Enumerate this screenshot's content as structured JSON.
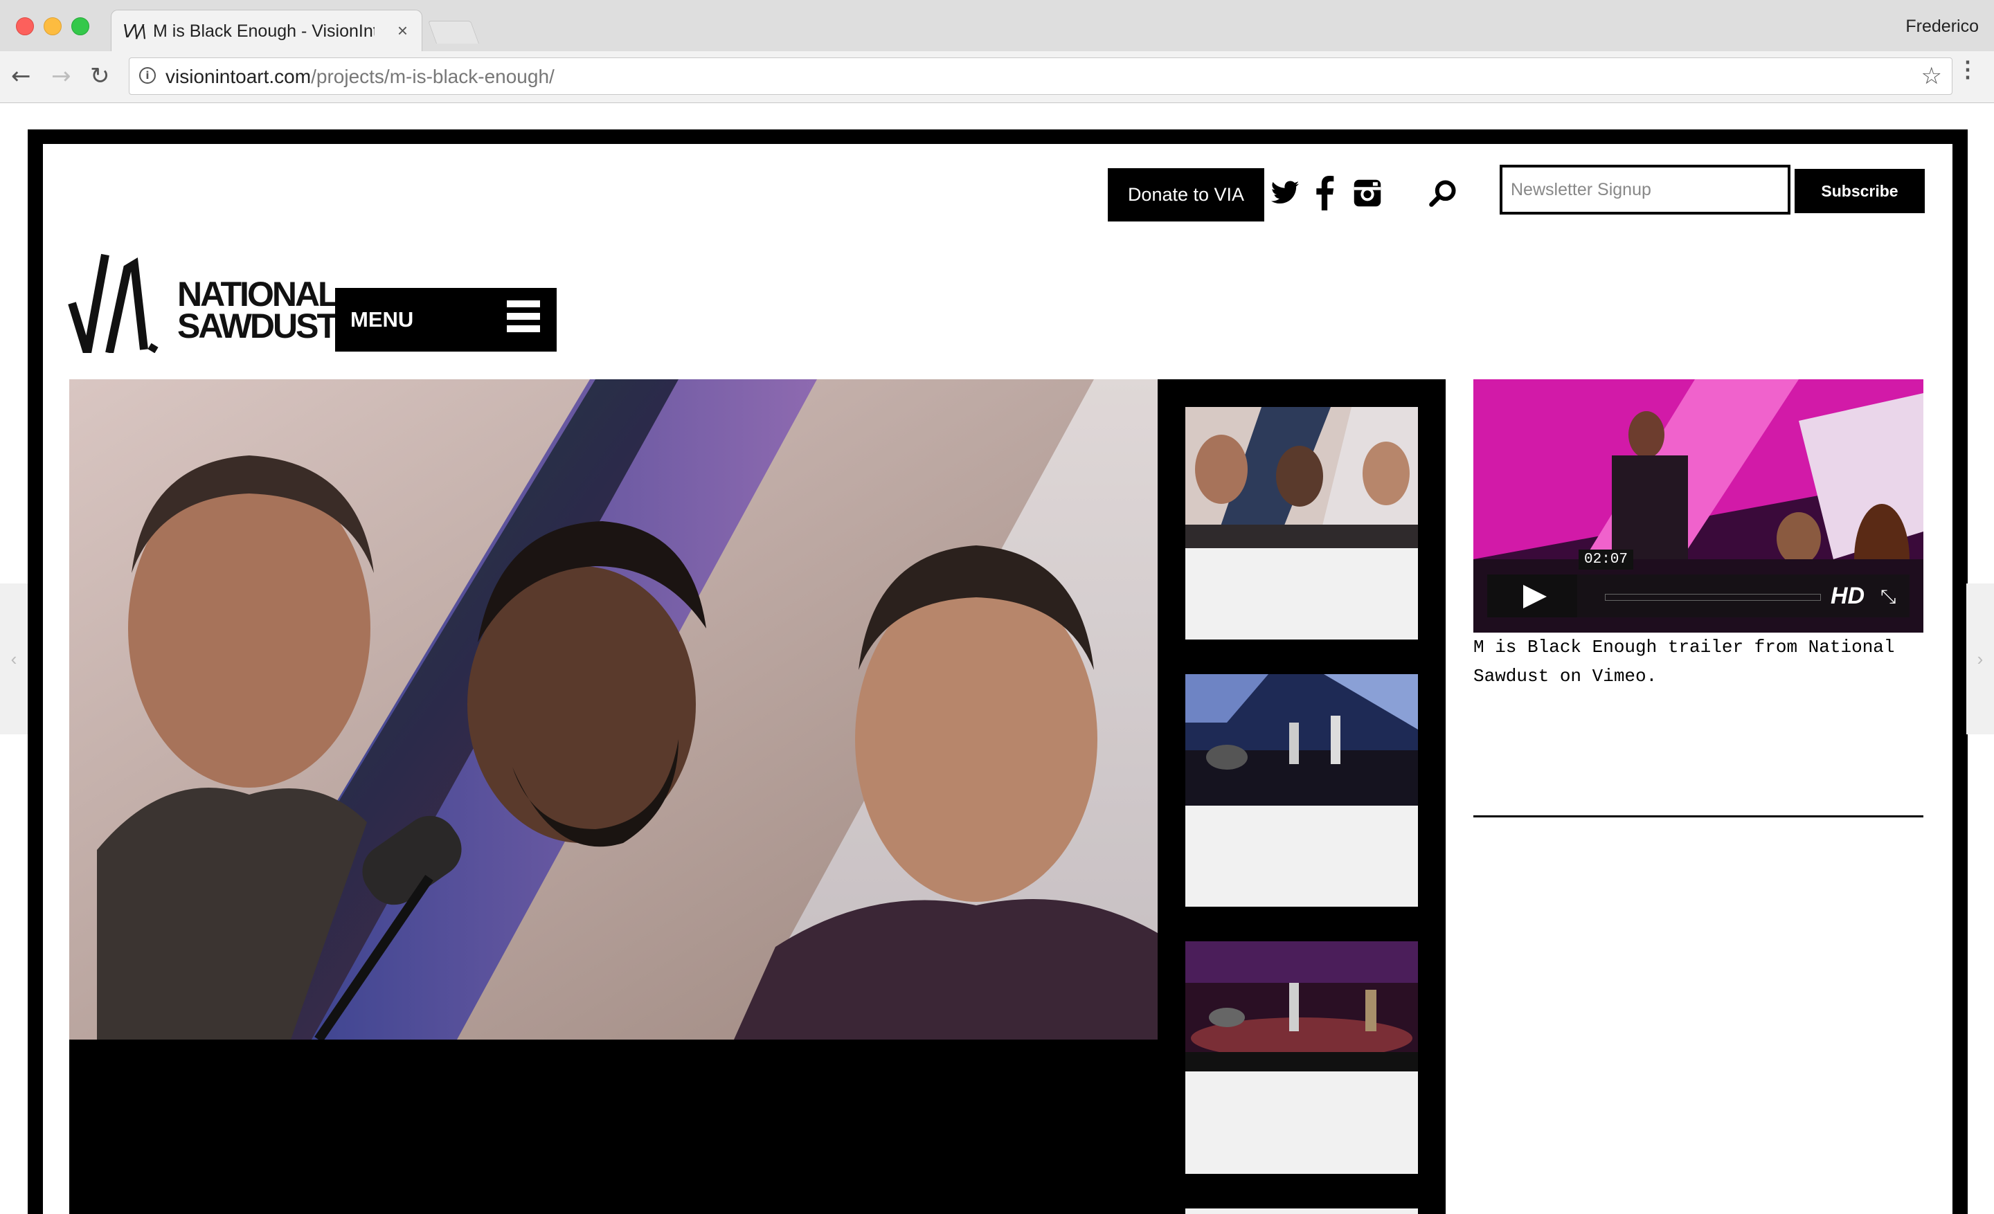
{
  "browser": {
    "tab_title": "M is Black Enough - VisionInto",
    "tab_favicon": "V\\/\\",
    "tab_close": "×",
    "profile_name": "Frederico",
    "url_domain": "visionintoart.com",
    "url_path": "/projects/m-is-black-enough/",
    "back_glyph": "←",
    "forward_glyph": "→",
    "reload_glyph": "↻",
    "star_glyph": "☆",
    "kebab_glyph": "⋮"
  },
  "header": {
    "donate_label": "Donate to VIA",
    "newsletter_placeholder": "Newsletter Signup",
    "newsletter_value": "",
    "subscribe_label": "Subscribe",
    "social_icons": [
      "twitter-icon",
      "facebook-icon",
      "instagram-icon",
      "search-icon"
    ]
  },
  "logo": {
    "mark": "VIA",
    "line1": "NATIONAL",
    "line2": "SAWDUST"
  },
  "menu": {
    "label": "MENU"
  },
  "side_arrows": {
    "left": "‹",
    "right": "›"
  },
  "video": {
    "time": "02:07",
    "hd": "HD",
    "fullscreen": "⤡",
    "caption": "M is Black Enough trailer from National Sawdust on Vimeo."
  },
  "colors": {
    "accent": "#000000",
    "chrome": "#dedede",
    "thumb_bg": "#f1f1f1",
    "video_magenta": "#d21aa8"
  }
}
